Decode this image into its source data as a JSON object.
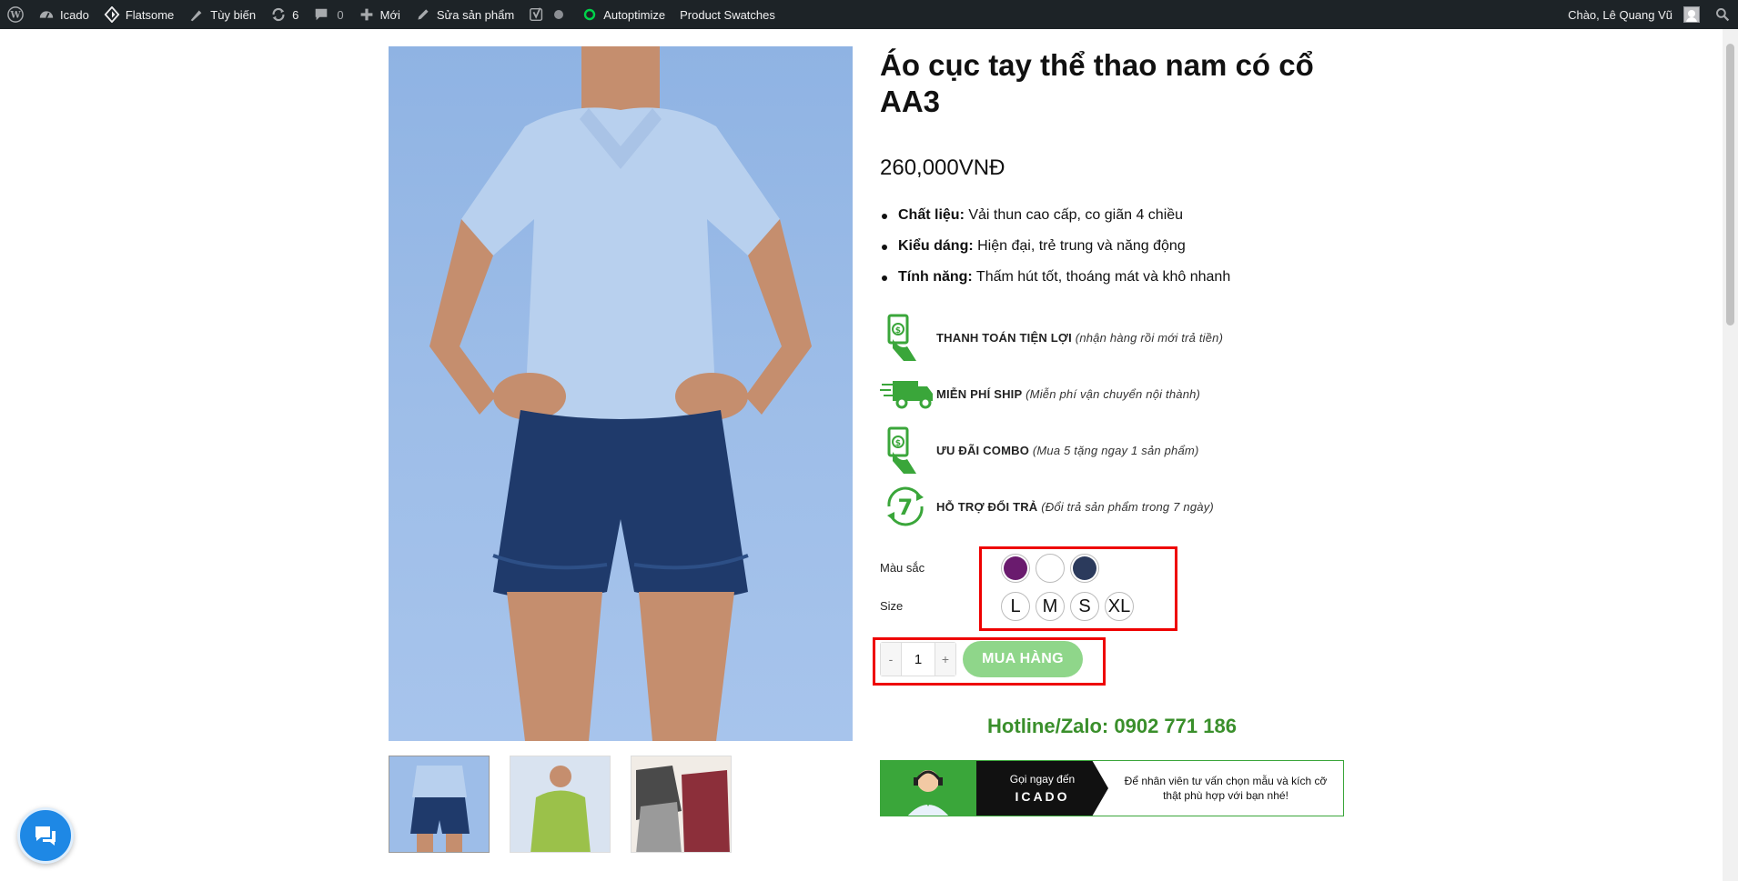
{
  "admin_bar": {
    "site_name": "Icado",
    "theme": "Flatsome",
    "customize": "Tùy biến",
    "updates_count": "6",
    "comments_count": "0",
    "new_label": "Mới",
    "edit_label": "Sửa sản phẩm",
    "autoptimize": "Autoptimize",
    "product_swatches": "Product Swatches",
    "greeting": "Chào, Lê Quang Vũ"
  },
  "product": {
    "title": "Áo cục tay thể thao nam có cổ AA3",
    "price": "260,000VNĐ",
    "features": [
      {
        "label": "Chất liệu:",
        "text": " Vải thun cao cấp, co giãn 4 chiều"
      },
      {
        "label": "Kiểu dáng:",
        "text": " Hiện đại, trẻ trung và năng động"
      },
      {
        "label": "Tính năng:",
        "text": " Thấm hút tốt, thoáng mát và khô nhanh"
      }
    ],
    "benefits": [
      {
        "title": "THANH TOÁN TIỆN LỢI",
        "note": "(nhận hàng rồi mới trả tiền)"
      },
      {
        "title": "MIỄN PHÍ SHIP",
        "note": "(Miễn phí vận chuyển nội thành)"
      },
      {
        "title": "ƯU ĐÃI COMBO",
        "note": "(Mua 5 tặng ngay 1 sản phẩm)"
      },
      {
        "title": "HỖ TRỢ ĐỔI TRẢ",
        "note": "(Đổi trả sản phẩm trong 7 ngày)"
      }
    ],
    "color_label": "Màu sắc",
    "colors": [
      "#6a1b6e",
      "#ffffff",
      "#2b3a5c"
    ],
    "size_label": "Size",
    "sizes": [
      "L",
      "M",
      "S",
      "XL"
    ],
    "quantity": {
      "minus": "-",
      "value": "1",
      "plus": "+"
    },
    "buy_label": "MUA HÀNG",
    "hotline": "Hotline/Zalo: 0902 771 186",
    "banner": {
      "call_text": "Gọi ngay đến",
      "brand": "ICADO",
      "description": "Để nhân viên tư vấn chọn mẫu và kích cỡ thật phù hợp với bạn nhé!"
    }
  },
  "colors": {
    "accent_green": "#3aa63a",
    "buy_button": "#8fd68a",
    "highlight_red": "#ee0000",
    "admin_bar": "#1d2327",
    "chat_button": "#1e88e5"
  }
}
